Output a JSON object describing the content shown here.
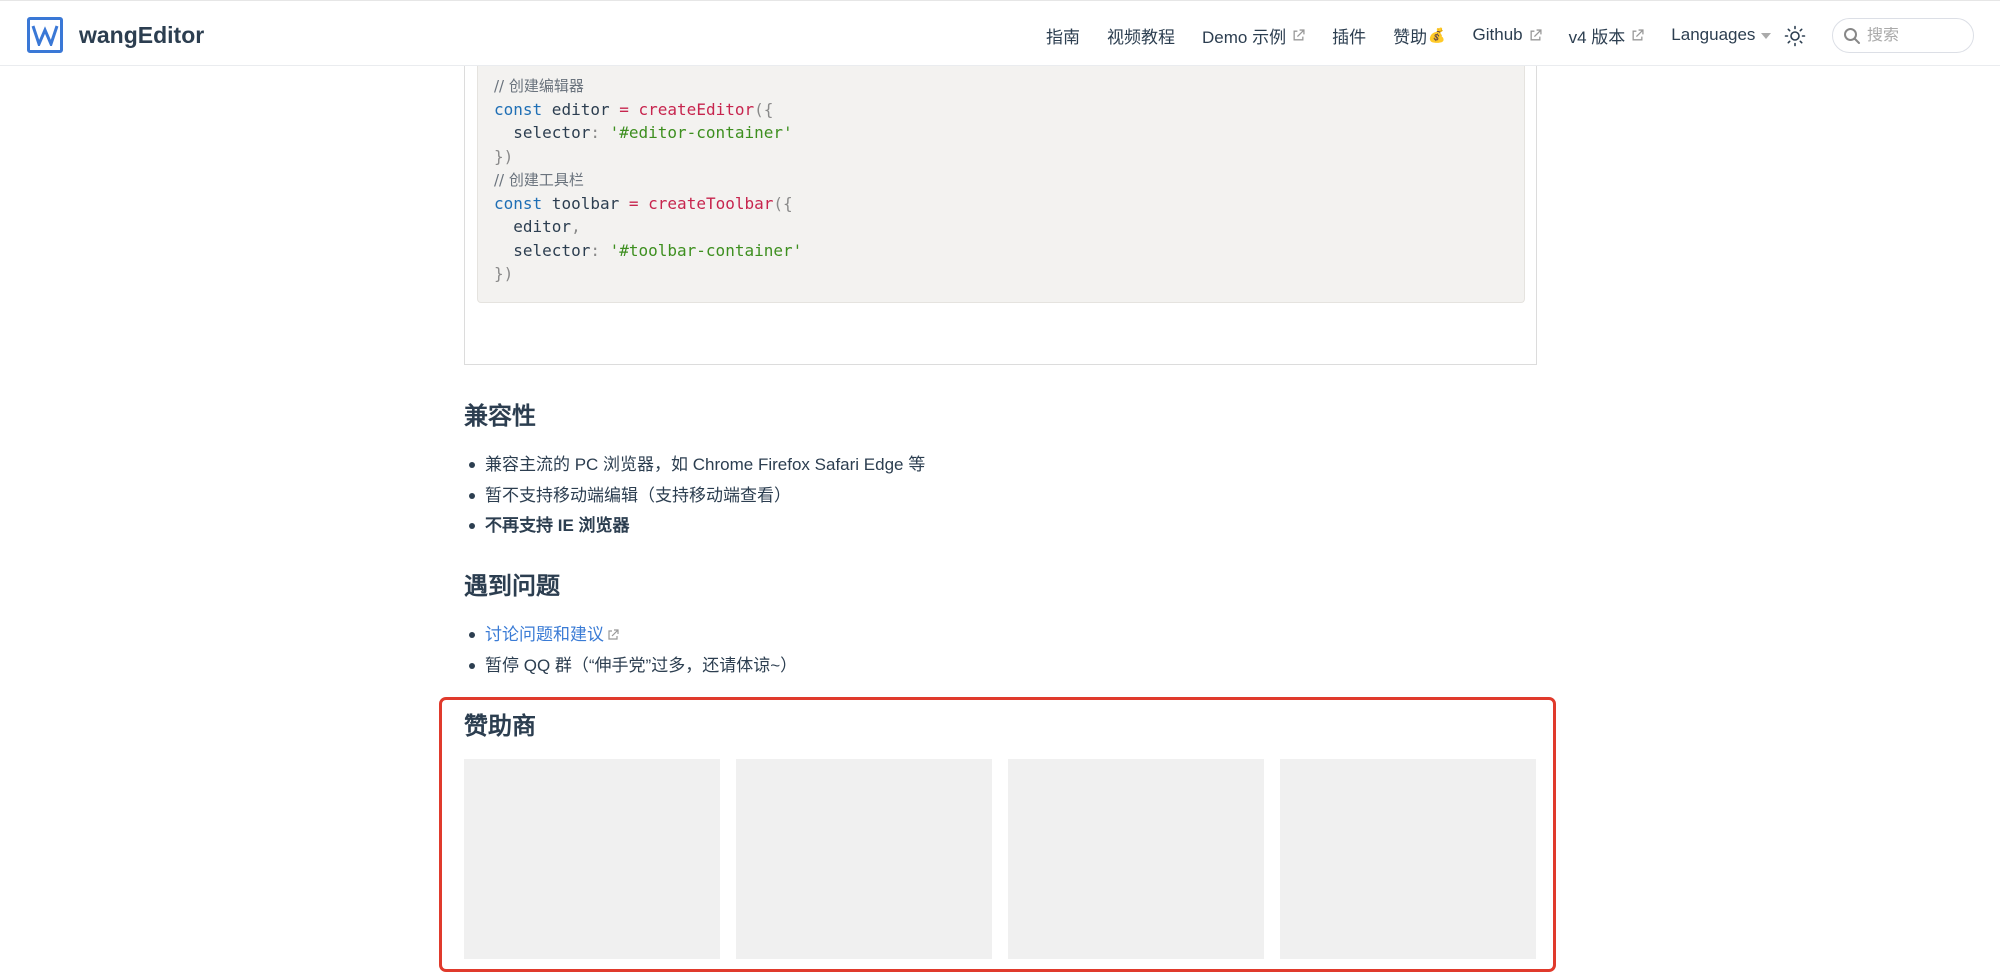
{
  "navbar": {
    "brand_name": "wangEditor",
    "items": [
      {
        "label": "指南",
        "external": false
      },
      {
        "label": "视频教程",
        "external": false
      },
      {
        "label": "Demo 示例",
        "external": true
      },
      {
        "label": "插件",
        "external": false
      },
      {
        "label": "赞助",
        "external": false,
        "emoji": "💰"
      },
      {
        "label": "Github",
        "external": true
      },
      {
        "label": "v4 版本",
        "external": true
      },
      {
        "label": "Languages",
        "dropdown": true
      }
    ],
    "search_placeholder": "搜索",
    "theme_icon": "sun-icon"
  },
  "code": {
    "lines": [
      {
        "parts": [
          {
            "t": "// 创建编辑器",
            "c": "comment"
          }
        ]
      },
      {
        "parts": [
          {
            "t": "const",
            "c": "kw"
          },
          {
            "t": " editor ",
            "c": "plain"
          },
          {
            "t": "=",
            "c": "fn"
          },
          {
            "t": " ",
            "c": "plain"
          },
          {
            "t": "createEditor",
            "c": "fn"
          },
          {
            "t": "({",
            "c": "punc"
          }
        ]
      },
      {
        "parts": [
          {
            "t": "  selector",
            "c": "plain"
          },
          {
            "t": ": ",
            "c": "punc"
          },
          {
            "t": "'#editor-container'",
            "c": "str"
          }
        ]
      },
      {
        "parts": [
          {
            "t": "})",
            "c": "punc"
          }
        ]
      },
      {
        "parts": [
          {
            "t": "// 创建工具栏",
            "c": "comment"
          }
        ]
      },
      {
        "parts": [
          {
            "t": "const",
            "c": "kw"
          },
          {
            "t": " toolbar ",
            "c": "plain"
          },
          {
            "t": "=",
            "c": "fn"
          },
          {
            "t": " ",
            "c": "plain"
          },
          {
            "t": "createToolbar",
            "c": "fn"
          },
          {
            "t": "({",
            "c": "punc"
          }
        ]
      },
      {
        "parts": [
          {
            "t": "  editor",
            "c": "plain"
          },
          {
            "t": ",",
            "c": "punc"
          }
        ]
      },
      {
        "parts": [
          {
            "t": "  selector",
            "c": "plain"
          },
          {
            "t": ": ",
            "c": "punc"
          },
          {
            "t": "'#toolbar-container'",
            "c": "str"
          }
        ]
      },
      {
        "parts": [
          {
            "t": "})",
            "c": "punc"
          }
        ]
      }
    ]
  },
  "compat": {
    "title": "兼容性",
    "items": [
      {
        "text": "兼容主流的 PC 浏览器，如 Chrome Firefox Safari Edge 等",
        "bold": false
      },
      {
        "text": "暂不支持移动端编辑（支持移动端查看）",
        "bold": false
      },
      {
        "text": "不再支持 IE 浏览器",
        "bold": true
      }
    ]
  },
  "issues": {
    "title": "遇到问题",
    "link_text": "讨论问题和建议",
    "qq_text": "暂停 QQ 群（“伸手党”过多，还请体谅~）"
  },
  "sponsors": {
    "title": "赞助商",
    "card_count": 4
  },
  "colors": {
    "accent": "#3a7bd5",
    "highlight": "#e03a2c",
    "code_bg": "#f3f2f0"
  }
}
